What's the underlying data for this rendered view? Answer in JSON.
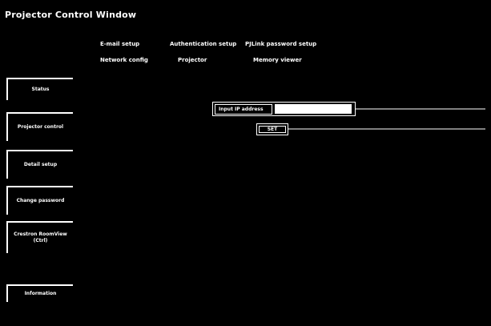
{
  "window": {
    "title": "Projector Control Window"
  },
  "top_links": {
    "row1": [
      "E-mail setup",
      "Authentication setup",
      "PJLink password setup"
    ],
    "row2": [
      "Network config",
      "Projector",
      "Memory viewer"
    ]
  },
  "sidebar": {
    "items": [
      {
        "label": "Status"
      },
      {
        "label": "Projector control"
      },
      {
        "label": "Detail setup"
      },
      {
        "label": "Change password"
      },
      {
        "label": "Crestron RoomView (Ctrl)"
      },
      {
        "label": "Information"
      }
    ]
  },
  "form": {
    "label": "Input IP address",
    "value": "",
    "placeholder": "",
    "button_label": "SET"
  },
  "colors": {
    "background": "#000000",
    "foreground": "#ffffff"
  }
}
